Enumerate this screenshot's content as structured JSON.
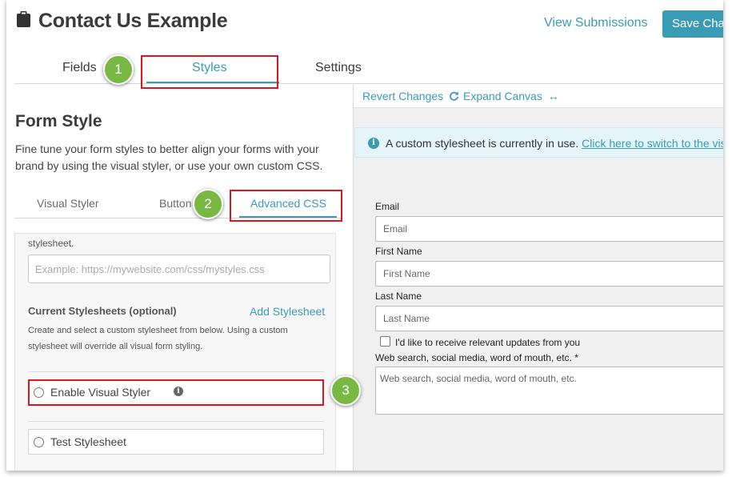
{
  "header": {
    "title": "Contact Us Example",
    "view_submissions": "View Submissions",
    "save_label": "Save Changes"
  },
  "main_tabs": [
    {
      "label": "Fields"
    },
    {
      "label": "Styles",
      "active": true
    },
    {
      "label": "Settings"
    }
  ],
  "form_style": {
    "title": "Form Style",
    "description": "Fine tune your form styles to better align your forms with your brand by using the visual styler, or use your own custom CSS."
  },
  "sub_tabs": [
    {
      "label": "Visual Styler"
    },
    {
      "label": "Button"
    },
    {
      "label": "Advanced CSS",
      "active": true
    }
  ],
  "advanced": {
    "stylesheet_text": "stylesheet.",
    "url_placeholder": "Example: https://mywebsite.com/css/mystyles.css",
    "current_title": "Current Stylesheets (optional)",
    "add_stylesheet": "Add Stylesheet",
    "current_desc": "Create and select a custom stylesheet from below. Using a custom stylesheet will override all visual form styling.",
    "options": [
      {
        "label": "Enable Visual Styler",
        "selected": false
      },
      {
        "label": "Test Stylesheet",
        "selected": false
      }
    ]
  },
  "canvas": {
    "revert": "Revert Changes",
    "expand": "Expand Canvas",
    "alert_text": "A custom stylesheet is currently in use.",
    "alert_link": "Click here to switch to the visual styler."
  },
  "preview_form": {
    "email_label": "Email",
    "email_placeholder": "Email",
    "first_label": "First Name",
    "first_placeholder": "First Name",
    "last_label": "Last Name",
    "last_placeholder": "Last Name",
    "checkbox_label": "I'd like to receive relevant updates from you",
    "source_label": "Web search, social media, word of mouth, etc. *",
    "source_placeholder": "Web search, social media, word of mouth, etc."
  },
  "callouts": [
    "1",
    "2",
    "3"
  ],
  "colors": {
    "accent": "#3a9bb4",
    "callout_badge": "#78b843",
    "highlight_border": "#e2141d"
  },
  "icons": [
    "clipboard-icon",
    "refresh-icon",
    "expand-arrows-icon",
    "info-icon"
  ]
}
